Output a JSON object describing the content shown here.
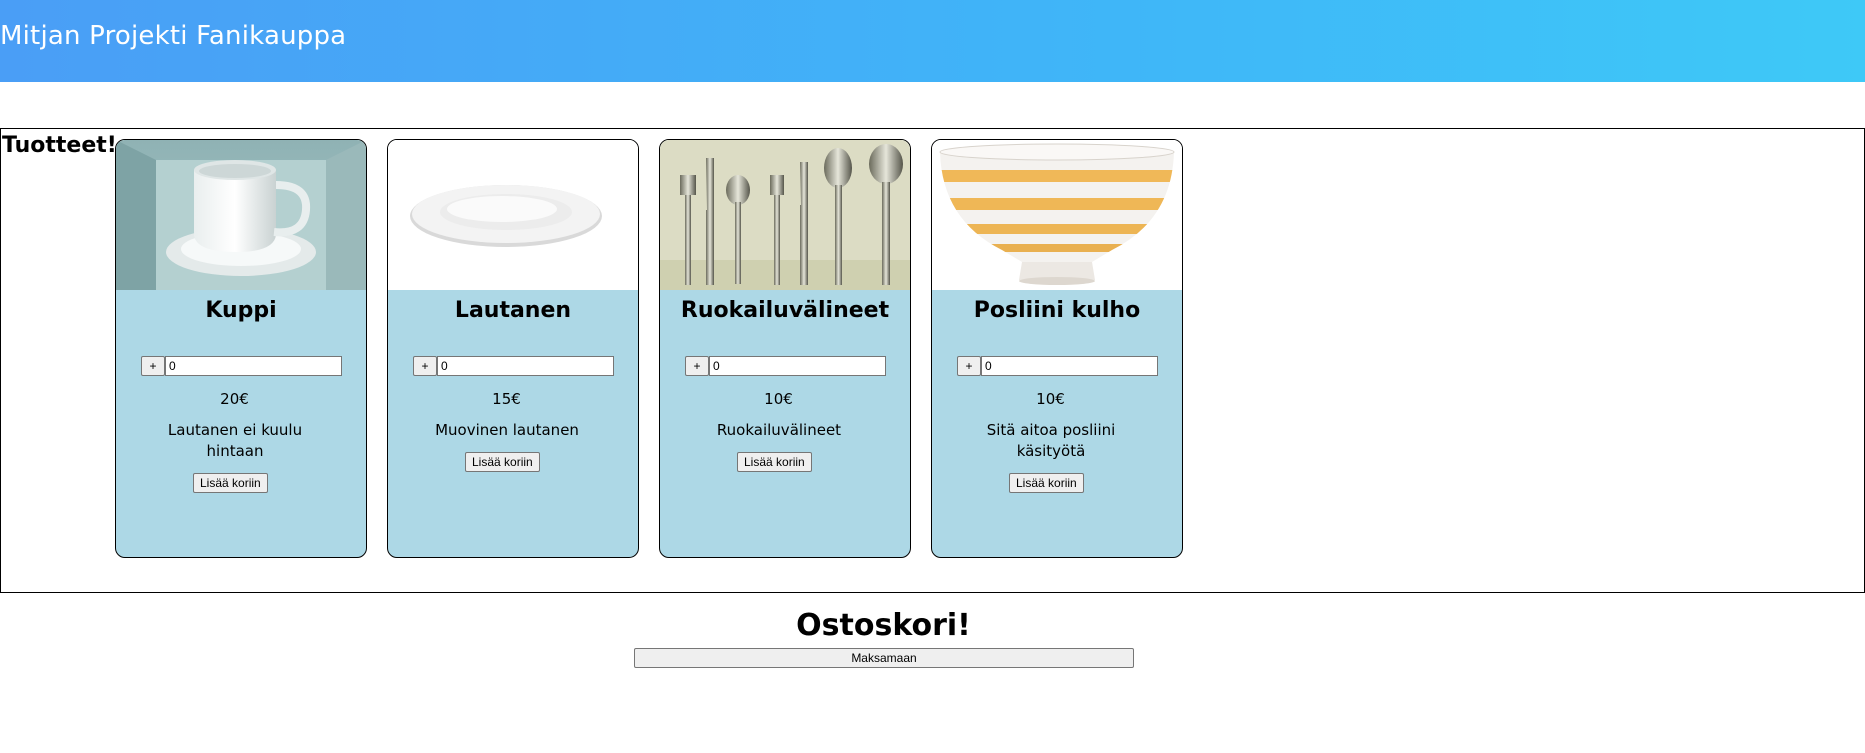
{
  "header": {
    "title": "Mitjan Projekti Fanikauppa"
  },
  "products_section": {
    "heading": "Tuotteet!",
    "products": [
      {
        "name": "Kuppi",
        "image": "white-cup-image",
        "plus_label": "+",
        "quantity": "0",
        "price": "20€",
        "description": "Lautanen ei kuulu hintaan",
        "add_label": "Lisää koriin"
      },
      {
        "name": "Lautanen",
        "image": "white-plate-image",
        "plus_label": "+",
        "quantity": "0",
        "price": "15€",
        "description": "Muovinen lautanen",
        "add_label": "Lisää koriin"
      },
      {
        "name": "Ruokailuvälineet",
        "image": "cutlery-image",
        "plus_label": "+",
        "quantity": "0",
        "price": "10€",
        "description": "Ruokailuvälineet",
        "add_label": "Lisää koriin"
      },
      {
        "name": "Posliini kulho",
        "image": "striped-bowl-image",
        "plus_label": "+",
        "quantity": "0",
        "price": "10€",
        "description": "Sitä aitoa posliini käsityötä",
        "add_label": "Lisää koriin"
      }
    ]
  },
  "cart": {
    "heading": "Ostoskori!",
    "checkout_label": "Maksamaan"
  },
  "colors": {
    "header_gradient_start": "#4a9ef6",
    "header_gradient_end": "#3ec9f7",
    "card_background": "#add8e6"
  }
}
